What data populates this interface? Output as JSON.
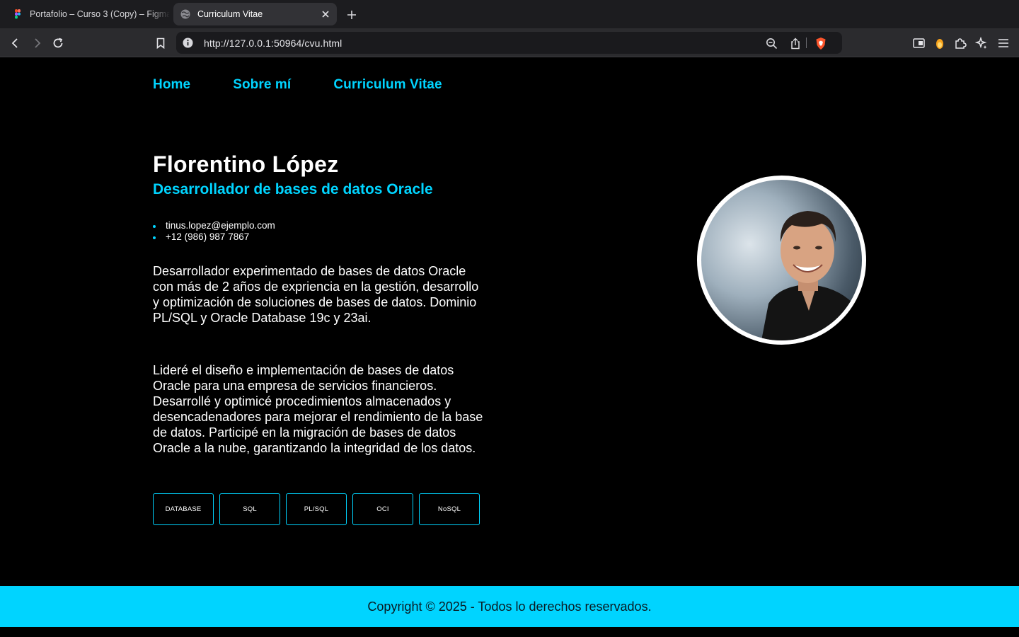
{
  "browser": {
    "tabs": [
      {
        "title": "Portafolio – Curso 3 (Copy) – Figma",
        "active": false,
        "icon": "figma-icon"
      },
      {
        "title": "Curriculum Vitae",
        "active": true,
        "icon": "globe-icon"
      }
    ],
    "url": "http://127.0.0.1:50964/cvu.html"
  },
  "page": {
    "nav": [
      "Home",
      "Sobre mí",
      "Curriculum Vitae"
    ],
    "name": "Florentino López",
    "role": "Desarrollador de bases de datos Oracle",
    "contacts": [
      "tinus.lopez@ejemplo.com",
      "+12 (986) 987 7867"
    ],
    "paragraphs": [
      "Desarrollador experimentado de bases de datos Oracle con más de 2 años de expriencia en la gestión, desarrollo y optimización de soluciones de bases de datos. Dominio PL/SQL y Oracle Database 19c y 23ai.",
      "Lideré el diseño e implementación de bases de datos Oracle para una empresa de servicios financieros. Desarrollé y optimicé procedimientos almacenados y desencadenadores para mejorar el rendimiento de la base de datos. Participé en la migración de bases de datos Oracle a la nube, garantizando la integridad de los datos."
    ],
    "skills": [
      "DATABASE",
      "SQL",
      "PL/SQL",
      "OCI",
      "NoSQL"
    ],
    "footer": "Copyright © 2025 - Todos lo derechos reservados."
  },
  "colors": {
    "accent": "#00d4ff",
    "background": "#000000",
    "text": "#ffffff"
  }
}
